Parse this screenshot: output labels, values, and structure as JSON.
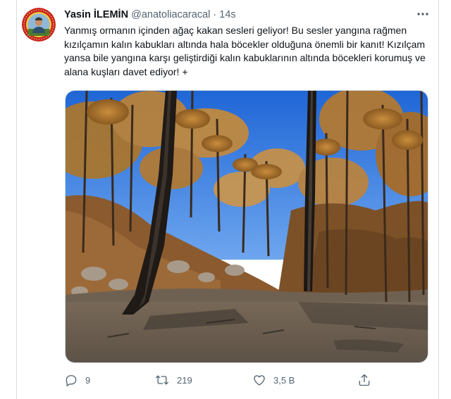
{
  "tweet": {
    "author": {
      "display_name": "Yasin İLEMİN",
      "handle": "@anatoliacaracal",
      "separator": "·",
      "time": "14s"
    },
    "text": "Yanmış ormanın içinden ağaç kakan sesleri geliyor! Bu sesler yangına rağmen kızılçamın kalın kabukları altında hala böcekler olduğuna önemli bir kanıt! Kızılçam yansa bile yangına karşı geliştirdiği kalın kabuklarının altında böcekleri korumuş ve alana kuşları davet ediyor! +",
    "more_icon": "more-horizontal-icon",
    "media_description_icon": "photo",
    "actions": {
      "reply": {
        "icon": "reply-icon",
        "count": "9"
      },
      "retweet": {
        "icon": "retweet-icon",
        "count": "219"
      },
      "like": {
        "icon": "heart-icon",
        "count": "3,5 B"
      },
      "share": {
        "icon": "share-icon"
      }
    },
    "colors": {
      "secondary_text": "#536471",
      "primary_text": "#0f1419",
      "border": "#cfd9de"
    }
  }
}
